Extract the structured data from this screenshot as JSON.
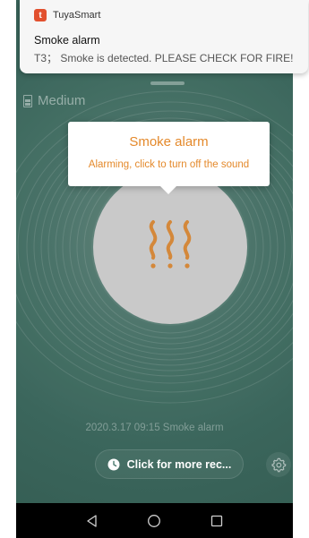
{
  "notification": {
    "app_name": "TuyaSmart",
    "app_logo_letter": "t",
    "title": "Smoke alarm",
    "body": "T3； Smoke is detected. PLEASE CHECK FOR FIRE!"
  },
  "device": {
    "battery_icon": "battery-icon",
    "battery_label": "Medium"
  },
  "popup": {
    "title": "Smoke alarm",
    "subtitle": "Alarming, click to turn off the sound",
    "accent_color": "#e4892b"
  },
  "main": {
    "status_icon": "smoke-icon",
    "last_alarm": "2020.3.17 09:15 Smoke alarm",
    "more_records_label": "Click for more rec...",
    "more_records_icon": "clock-icon",
    "settings_icon": "gear-icon"
  },
  "navbar": {
    "back_icon": "back-triangle-icon",
    "home_icon": "home-circle-icon",
    "recents_icon": "recents-square-icon"
  },
  "colors": {
    "background": "#4f7b70",
    "circle": "#c9c9c9",
    "notification_bg": "#f6f6f6"
  }
}
